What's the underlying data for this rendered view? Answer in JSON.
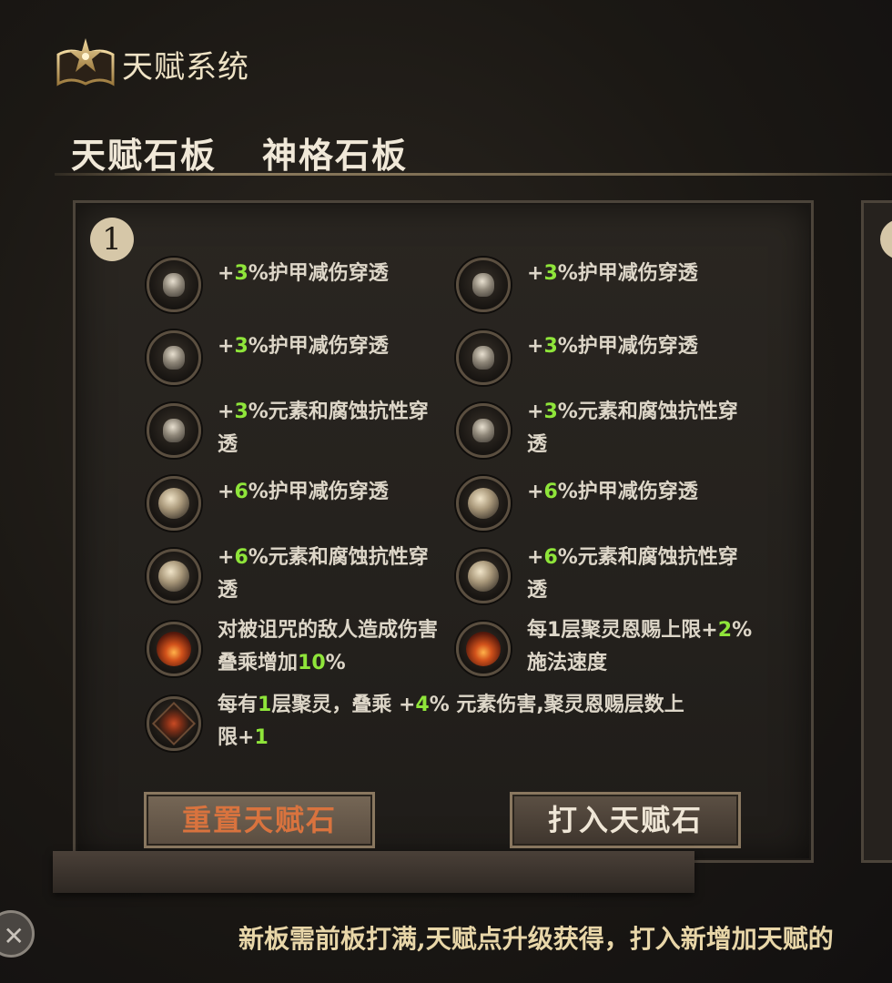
{
  "header": {
    "title": "天赋系统",
    "logo_icon": "open-book-star-icon"
  },
  "tabs": [
    {
      "label": "天赋石板"
    },
    {
      "label": "神格石板"
    }
  ],
  "board": {
    "number": "1",
    "talents": [
      {
        "icon": "small-gem-icon",
        "pre": "+",
        "hl": "3",
        "post": "%护甲减伤穿透"
      },
      {
        "icon": "small-gem-icon",
        "pre": "+",
        "hl": "3",
        "post": "%护甲减伤穿透"
      },
      {
        "icon": "small-gem-icon",
        "pre": "+",
        "hl": "3",
        "post": "%护甲减伤穿透"
      },
      {
        "icon": "small-gem-icon",
        "pre": "+",
        "hl": "3",
        "post": "%护甲减伤穿透"
      },
      {
        "icon": "small-gem-icon",
        "pre": "+",
        "hl": "3",
        "post": "%元素和腐蚀抗性穿",
        "line2": "透"
      },
      {
        "icon": "small-gem-icon",
        "pre": "+",
        "hl": "3",
        "post": "%元素和腐蚀抗性穿",
        "line2": "透"
      },
      {
        "icon": "orb-gem-icon",
        "pre": "+",
        "hl": "6",
        "post": "%护甲减伤穿透"
      },
      {
        "icon": "orb-gem-icon",
        "pre": "+",
        "hl": "6",
        "post": "%护甲减伤穿透"
      },
      {
        "icon": "orb-gem-icon",
        "pre": "+",
        "hl": "6",
        "post": "%元素和腐蚀抗性穿",
        "line2": "透"
      },
      {
        "icon": "orb-gem-icon",
        "pre": "+",
        "hl": "6",
        "post": "%元素和腐蚀抗性穿",
        "line2": "透"
      },
      {
        "icon": "fire-gem-icon",
        "line1": "对被诅咒的敌人造成伤害",
        "pre2": "叠乘增加",
        "hl2": "10",
        "post2": "%"
      },
      {
        "icon": "fire-gem-icon",
        "line1a": "每1层聚灵恩赐上限+",
        "hl1": "2",
        "line1b": "%",
        "line2": "施法速度"
      },
      {
        "icon": "rune-stone-icon",
        "pre": "每有",
        "hl": "1",
        "mid": "层聚灵，叠乘 +",
        "hl_b": "4",
        "post": "% 元素伤害,聚灵恩赐层数上",
        "pre2": "限+",
        "hl2": "1"
      }
    ]
  },
  "buttons": {
    "reset": "重置天赋石",
    "insert": "打入天赋石"
  },
  "hint": "新板需前板打满,天赋点升级获得，打入新增加天赋的",
  "close_icon": "close-icon",
  "colors": {
    "highlight": "#8fe53a",
    "reset_text": "#d9733e"
  }
}
